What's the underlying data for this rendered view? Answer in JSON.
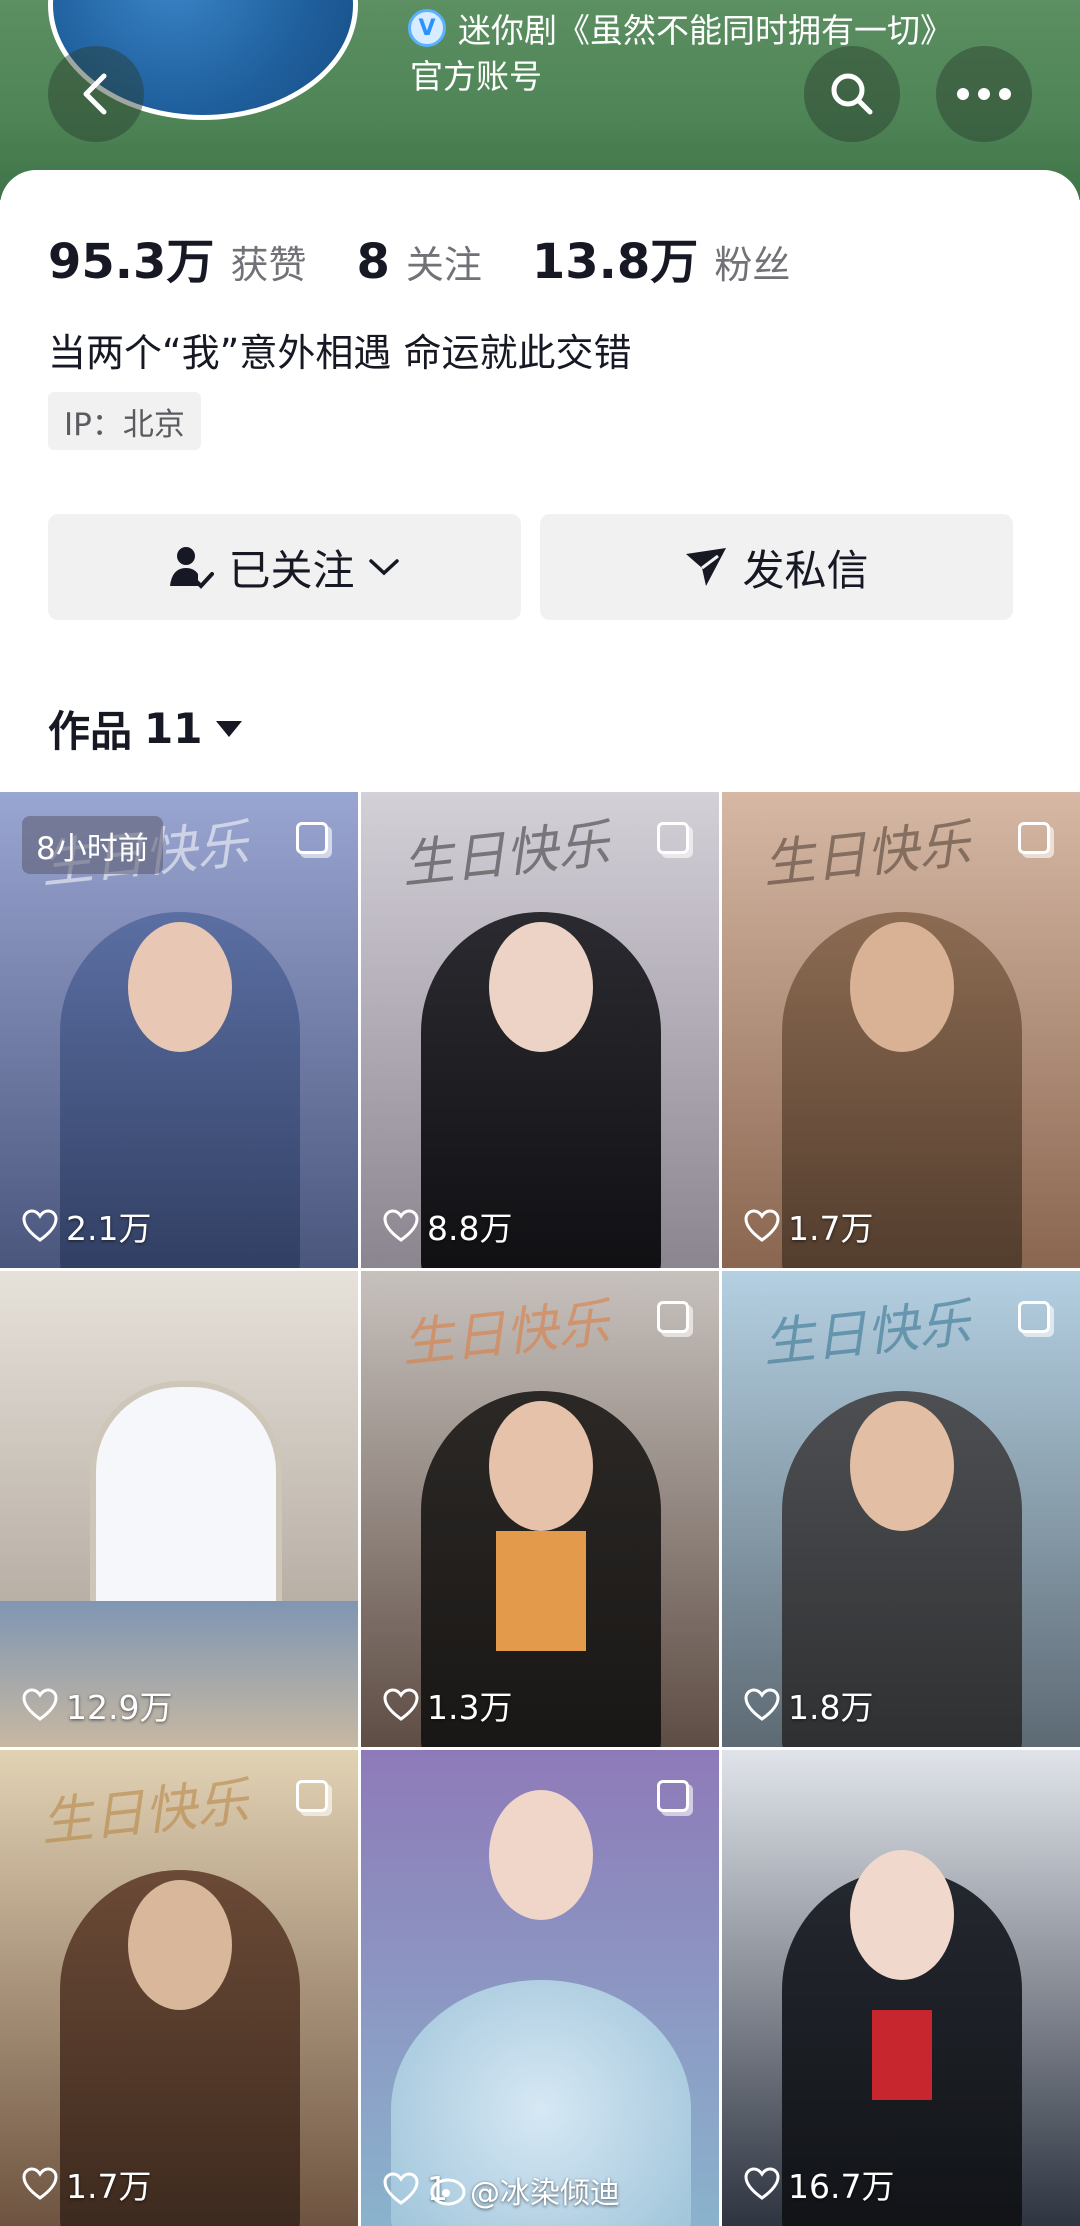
{
  "header": {
    "account_verified_name": "迷你剧《虽然不能同时拥有一切》",
    "account_type": "官方账号",
    "avatar_icon": "avatar-logo",
    "background_color": "#4f8557"
  },
  "stats": [
    {
      "value": "95.3万",
      "label": "获赞"
    },
    {
      "value": "8",
      "label": "关注"
    },
    {
      "value": "13.8万",
      "label": "粉丝"
    }
  ],
  "bio": "当两个“我”意外相遇 命运就此交错",
  "ip": "IP：北京",
  "buttons": {
    "follow_label": "已关注",
    "message_label": "发私信"
  },
  "works": {
    "label": "作品",
    "count": "11"
  },
  "tiles": [
    {
      "likes": "2.1万",
      "badge": "8小时前",
      "color_top": "#8f9bc6",
      "color_bottom": "#4d5b7e"
    },
    {
      "likes": "8.8万",
      "badge": "",
      "color_top": "#c6c3cc",
      "color_bottom": "#6e6a74"
    },
    {
      "likes": "1.7万",
      "badge": "",
      "color_top": "#c9a996",
      "color_bottom": "#8a6650"
    },
    {
      "likes": "12.9万",
      "badge": "",
      "color_top": "#dcd6cf",
      "color_bottom": "#9c948a"
    },
    {
      "likes": "1.3万",
      "badge": "",
      "color_top": "#b9b4b2",
      "color_bottom": "#66554c"
    },
    {
      "likes": "1.8万",
      "badge": "",
      "color_top": "#a9c4d6",
      "color_bottom": "#52606a"
    },
    {
      "likes": "1.7万",
      "badge": "",
      "color_top": "#d8c7a8",
      "color_bottom": "#6e5440"
    },
    {
      "likes": "1",
      "badge": "",
      "color_top": "#8f7bb8",
      "color_bottom": "#8ab3cc"
    },
    {
      "likes": "16.7万",
      "badge": "",
      "color_top": "#d7dbe0",
      "color_bottom": "#2e3440"
    }
  ],
  "watermark": "@冰染倾迪"
}
